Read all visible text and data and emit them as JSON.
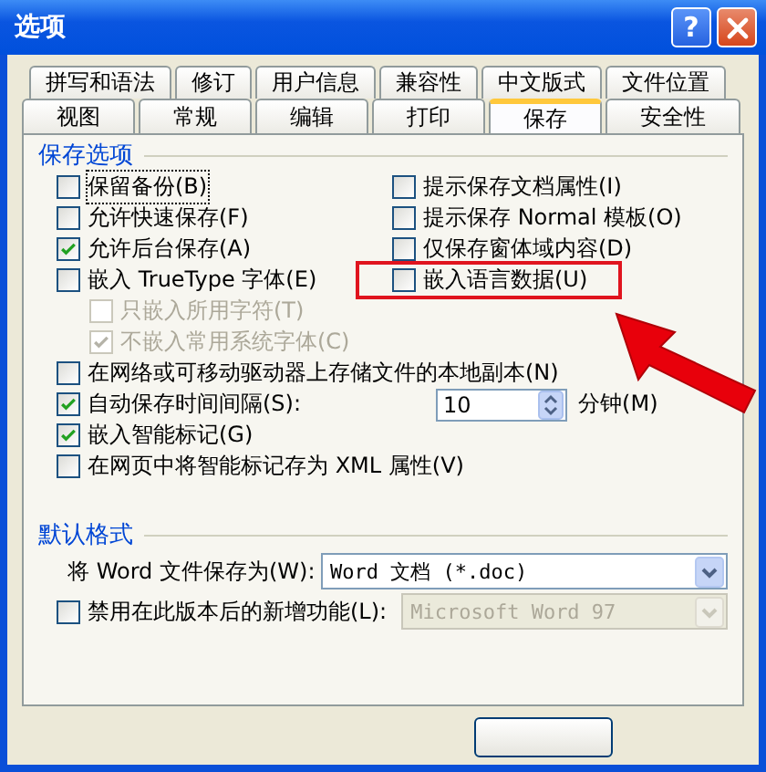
{
  "window": {
    "title": "选项",
    "help": "?"
  },
  "tabs_back": [
    {
      "label": "拼写和语法",
      "selected": false
    },
    {
      "label": "修订",
      "selected": false
    },
    {
      "label": "用户信息",
      "selected": false
    },
    {
      "label": "兼容性",
      "selected": false
    },
    {
      "label": "中文版式",
      "selected": false
    },
    {
      "label": "文件位置",
      "selected": false
    }
  ],
  "tabs_front": [
    {
      "label": "视图",
      "selected": false
    },
    {
      "label": "常规",
      "selected": false
    },
    {
      "label": "编辑",
      "selected": false
    },
    {
      "label": "打印",
      "selected": false
    },
    {
      "label": "保存",
      "selected": true
    },
    {
      "label": "安全性",
      "selected": false
    }
  ],
  "save_options": {
    "title": "保存选项",
    "left": [
      {
        "label": "保留备份(B)",
        "checked": false,
        "focused": true
      },
      {
        "label": "允许快速保存(F)",
        "checked": false
      },
      {
        "label": "允许后台保存(A)",
        "checked": true
      },
      {
        "label": "嵌入 TrueType 字体(E)",
        "checked": false,
        "children": [
          {
            "label": "只嵌入所用字符(T)",
            "checked": false,
            "disabled": true
          },
          {
            "label": "不嵌入常用系统字体(C)",
            "checked": true,
            "disabled": true
          }
        ]
      }
    ],
    "right": [
      {
        "label": "提示保存文档属性(I)",
        "checked": false
      },
      {
        "label": "提示保存 Normal 模板(O)",
        "checked": false
      },
      {
        "label": "仅保存窗体域内容(D)",
        "checked": false
      },
      {
        "label": "嵌入语言数据(U)",
        "checked": false,
        "highlighted": true
      }
    ],
    "rows": [
      {
        "label": "在网络或可移动驱动器上存储文件的本地副本(N)",
        "checked": false
      },
      {
        "label": "自动保存时间间隔(S):",
        "checked": true,
        "spin": {
          "value": "10",
          "unit": "分钟(M)"
        }
      },
      {
        "label": "嵌入智能标记(G)",
        "checked": true
      },
      {
        "label": "在网页中将智能标记存为 XML 属性(V)",
        "checked": false
      }
    ]
  },
  "default_format": {
    "title": "默认格式",
    "save_as": {
      "label": "将 Word 文件保存为(W):",
      "value": "Word 文档 (*.doc)"
    },
    "compat": {
      "label": "禁用在此版本后的新增功能(L):",
      "checked": false,
      "value": "Microsoft Word 97",
      "disabled": true
    }
  }
}
